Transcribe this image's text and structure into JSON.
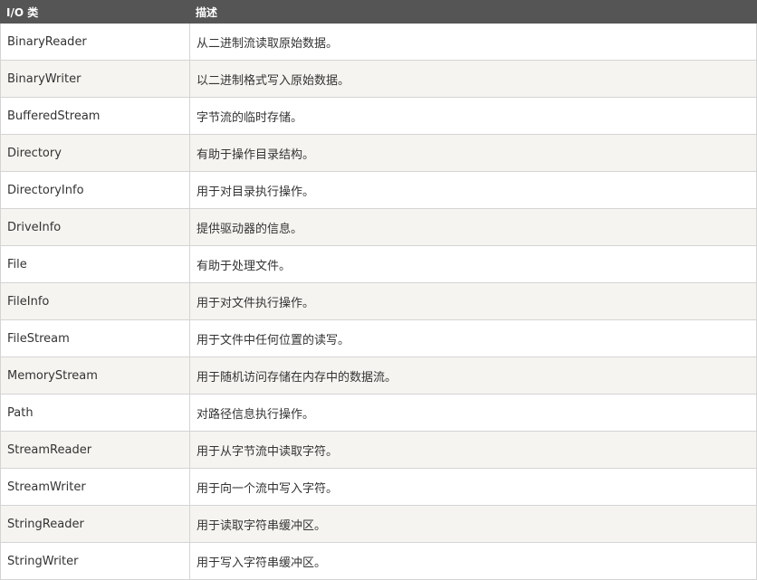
{
  "table": {
    "headers": [
      "I/O 类",
      "描述"
    ],
    "rows": [
      {
        "name": "BinaryReader",
        "desc": "从二进制流读取原始数据。"
      },
      {
        "name": "BinaryWriter",
        "desc": "以二进制格式写入原始数据。"
      },
      {
        "name": "BufferedStream",
        "desc": "字节流的临时存储。"
      },
      {
        "name": "Directory",
        "desc": "有助于操作目录结构。"
      },
      {
        "name": "DirectoryInfo",
        "desc": "用于对目录执行操作。"
      },
      {
        "name": "DriveInfo",
        "desc": "提供驱动器的信息。"
      },
      {
        "name": "File",
        "desc": "有助于处理文件。"
      },
      {
        "name": "FileInfo",
        "desc": "用于对文件执行操作。"
      },
      {
        "name": "FileStream",
        "desc": "用于文件中任何位置的读写。"
      },
      {
        "name": "MemoryStream",
        "desc": "用于随机访问存储在内存中的数据流。"
      },
      {
        "name": "Path",
        "desc": "对路径信息执行操作。"
      },
      {
        "name": "StreamReader",
        "desc": "用于从字节流中读取字符。"
      },
      {
        "name": "StreamWriter",
        "desc": "用于向一个流中写入字符。"
      },
      {
        "name": "StringReader",
        "desc": "用于读取字符串缓冲区。"
      },
      {
        "name": "StringWriter",
        "desc": "用于写入字符串缓冲区。"
      }
    ]
  },
  "colors": {
    "header_bg": "#555555",
    "header_text": "#ffffff",
    "row_alt_bg": "#f6f4f0",
    "border": "#d4d4d4"
  }
}
